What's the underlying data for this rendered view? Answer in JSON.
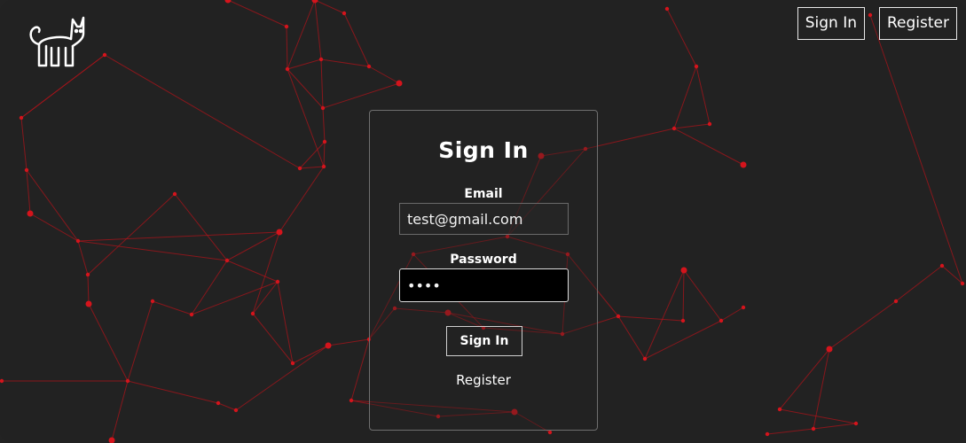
{
  "colors": {
    "background": "#222222",
    "network_line": "#b3121a",
    "network_node": "#d4141c",
    "text": "#ffffff"
  },
  "header": {
    "logo_icon": "cat-icon",
    "nav": {
      "sign_in_label": "Sign In",
      "register_label": "Register"
    }
  },
  "login_form": {
    "title": "Sign In",
    "email": {
      "label": "Email",
      "value": "test@gmail.com"
    },
    "password": {
      "label": "Password",
      "value": "••••"
    },
    "submit_label": "Sign In",
    "register_link": "Register"
  }
}
